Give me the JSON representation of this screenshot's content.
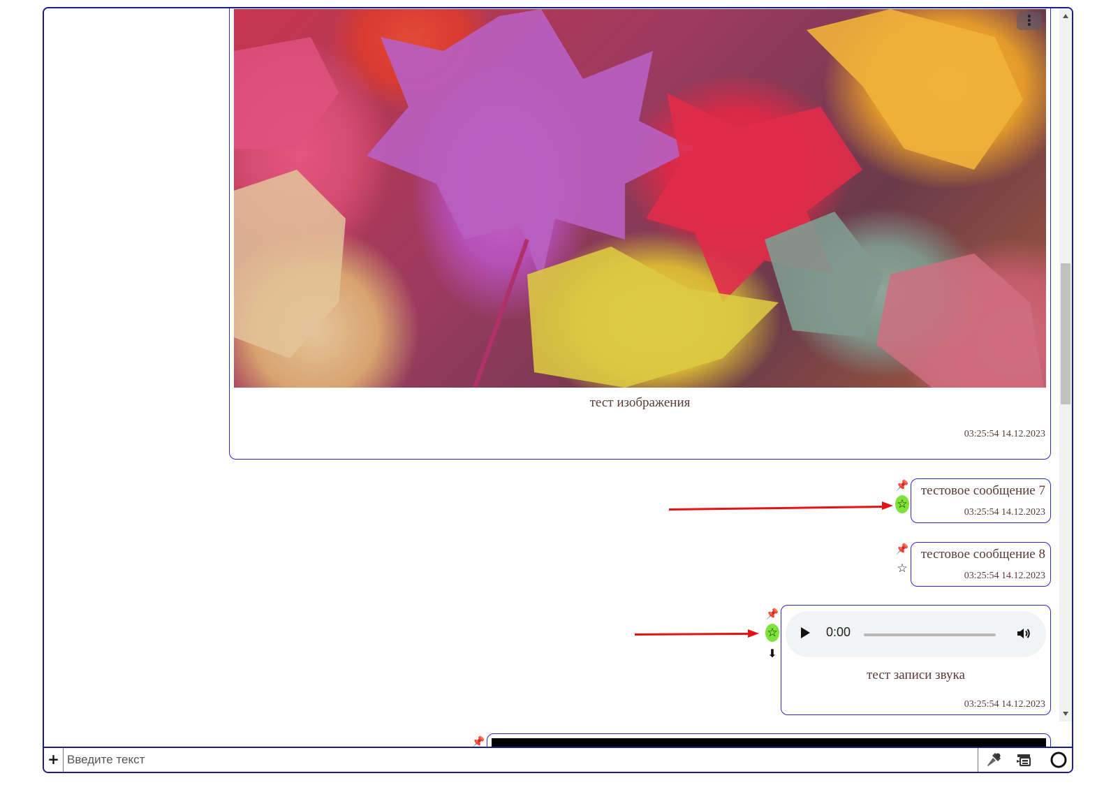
{
  "messages": [
    {
      "type": "image",
      "caption": "тест изображения",
      "time": "03:25:54 14.12.2023",
      "menu_icon": "⋮"
    },
    {
      "type": "text",
      "text": "тестовое сообщение 7",
      "time": "03:25:54 14.12.2023",
      "starred": true
    },
    {
      "type": "text",
      "text": "тестовое сообщение 8",
      "time": "03:25:54 14.12.2023",
      "starred": false
    },
    {
      "type": "audio",
      "current_time": "0:00",
      "caption": "тест записи звука",
      "time": "03:25:54 14.12.2023",
      "starred": true
    }
  ],
  "icons": {
    "pin": "📌",
    "star": "☆",
    "download": "⬇"
  },
  "input": {
    "plus_label": "+",
    "placeholder": "Введите текст"
  },
  "colors": {
    "frame_border": "#1c1c8e",
    "bubble_border": "#2b2bd0",
    "star_highlight": "#7fe23a",
    "annotation_arrow": "#e41414"
  }
}
